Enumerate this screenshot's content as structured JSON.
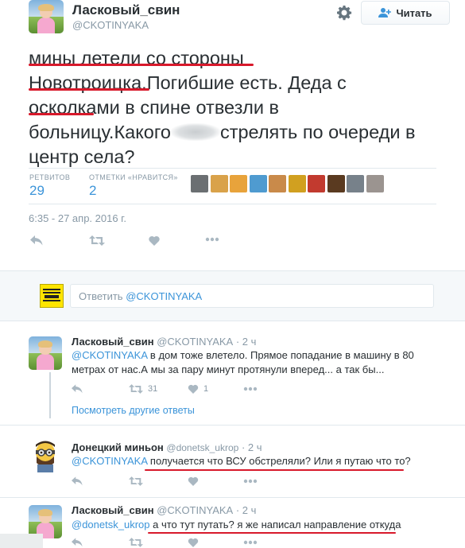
{
  "tweet": {
    "author_name": "Ласковый_свин",
    "author_handle": "@CKOTINYAKA",
    "follow_label": "Читать",
    "text_lines": [
      "мины летели со стороны",
      "Новотроицка.Погибшие есть. Деда с",
      "осколками в спине отвезли в",
      "больницу.Какого",
      "стрелять по очереди в",
      "центр села?"
    ],
    "retweets_label": "РЕТВИТОВ",
    "retweets_count": "29",
    "likes_label": "ОТМЕТКИ «НРАВИТСЯ»",
    "likes_count": "2",
    "likers": [
      "#6b6f72",
      "#d9a24a",
      "#e8a33b",
      "#4f9bd0",
      "#c98a4a",
      "#d1a020",
      "#c23a2f",
      "#5a3a20",
      "#77818a",
      "#9b9490"
    ],
    "timestamp": "6:35 - 27 апр. 2016 г."
  },
  "reply_box": {
    "prefix": "Ответить",
    "mention": "@CKOTINYAKA"
  },
  "replies": [
    {
      "name": "Ласковый_свин",
      "handle": "@CKOTINYAKA",
      "age": "· 2 ч",
      "mention": "@CKOTINYAKA",
      "text": " в дом тоже влетело. Прямое попадание в машину в 80 метрах от нас.А мы за пару минут протянули вперед... а так бы...",
      "retweets": "31",
      "likes": "1",
      "more_label": "Посмотреть другие ответы"
    },
    {
      "name": "Донецкий миньон",
      "handle": "@donetsk_ukrop",
      "age": "· 2 ч",
      "mention": "@CKOTINYAKA",
      "text": " получается что ВСУ обстреляли? Или я путаю что то?"
    },
    {
      "name": "Ласковый_свин",
      "handle": "@CKOTINYAKA",
      "age": "· 2 ч",
      "mention": "@donetsk_ukrop",
      "text": " а что тут путать? я же написал направление откуда"
    }
  ],
  "colors": {
    "link": "#3b94d9",
    "text": "#292f33",
    "muted": "#8899a6",
    "underline": "#d8192b"
  },
  "icons": [
    "gear-icon",
    "follow-user-icon",
    "reply-icon",
    "retweet-icon",
    "like-icon",
    "more-icon"
  ]
}
